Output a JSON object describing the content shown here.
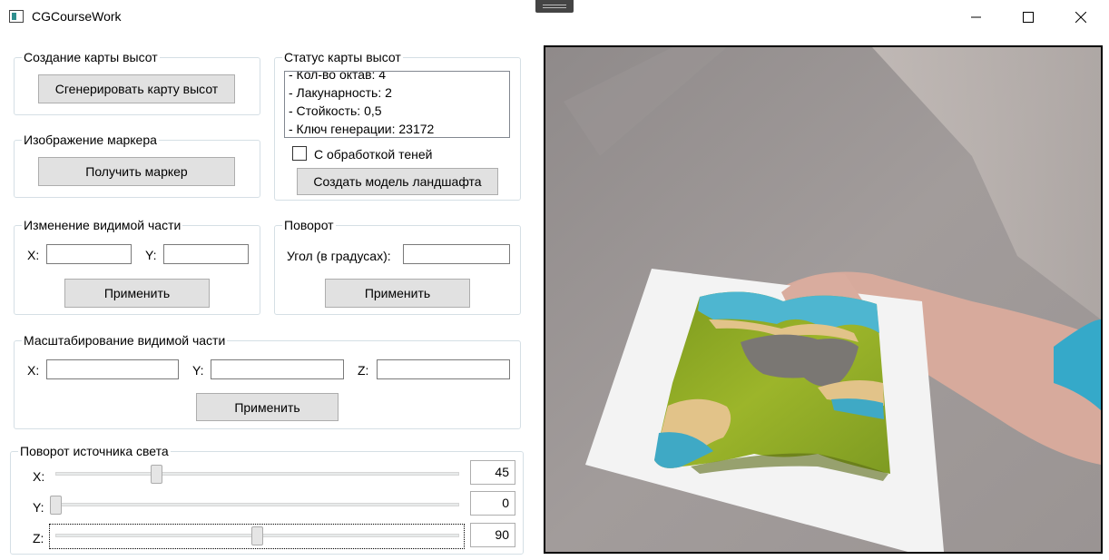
{
  "window": {
    "title": "CGCourseWork"
  },
  "heightmap_creation": {
    "legend": "Создание карты высот",
    "generate_button": "Сгенерировать карту высот"
  },
  "marker_image": {
    "legend": "Изображение маркера",
    "get_marker_button": "Получить маркер"
  },
  "heightmap_status": {
    "legend": "Статус карты высот",
    "lines": [
      "- Кол-во октав: 4",
      "- Лакунарность: 2",
      "- Стойкость: 0,5",
      "- Ключ генерации: 23172"
    ],
    "shadows_checkbox_label": "С обработкой теней",
    "shadows_checked": false,
    "create_model_button": "Создать модель ландшафта"
  },
  "visible_part": {
    "legend": "Изменение видимой части",
    "x_label": "X:",
    "y_label": "Y:",
    "x_value": "",
    "y_value": "",
    "apply_button": "Применить"
  },
  "rotation": {
    "legend": "Поворот",
    "angle_label": "Угол (в градусах):",
    "angle_value": "",
    "apply_button": "Применить"
  },
  "scaling": {
    "legend": "Масштабирование видимой части",
    "x_label": "X:",
    "y_label": "Y:",
    "z_label": "Z:",
    "x_value": "",
    "y_value": "",
    "z_value": "",
    "apply_button": "Применить"
  },
  "light_rotation": {
    "legend": "Поворот источника света",
    "sliders": [
      {
        "label": "X:",
        "value": "45",
        "fraction": 0.25
      },
      {
        "label": "Y:",
        "value": "0",
        "fraction": 0.0
      },
      {
        "label": "Z:",
        "value": "90",
        "fraction": 0.5
      }
    ]
  },
  "icons": {
    "app": "app-window-icon",
    "minimize": "minimize-icon",
    "maximize": "maximize-icon",
    "close": "close-icon"
  },
  "colors": {
    "button_bg": "#e1e1e1",
    "group_border": "#d5dfe5",
    "camera_border": "#000000"
  }
}
